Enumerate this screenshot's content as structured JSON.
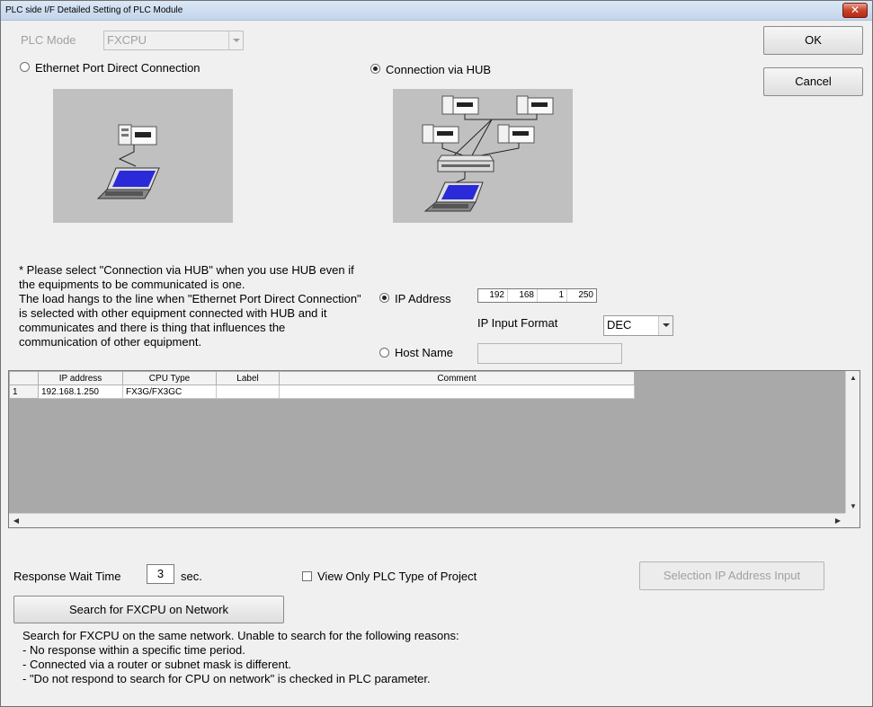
{
  "window": {
    "title": "PLC side I/F Detailed Setting of PLC Module",
    "close_label": "✕"
  },
  "buttons": {
    "ok": "OK",
    "cancel": "Cancel",
    "search": "Search for FXCPU on Network",
    "selection_ip": "Selection IP Address Input"
  },
  "plc_mode": {
    "label": "PLC Mode",
    "value": "FXCPU"
  },
  "connection": {
    "direct_label": "Ethernet Port Direct Connection",
    "hub_label": "Connection via HUB",
    "selected": "hub"
  },
  "note_lines": [
    "* Please select \"Connection via HUB\" when you use HUB even if",
    "the equipments to be communicated is one.",
    "The load hangs to the line when \"Ethernet Port Direct Connection\"",
    "is selected with other equipment connected with HUB and it",
    "communicates and there is thing that influences the",
    "communication of other equipment."
  ],
  "address": {
    "ip_label": "IP Address",
    "ip_octets": [
      "192",
      "168",
      "1",
      "250"
    ],
    "input_format_label": "IP Input Format",
    "input_format_value": "DEC",
    "host_label": "Host Name",
    "selected": "ip"
  },
  "grid": {
    "columns": [
      "IP address",
      "CPU Type",
      "Label",
      "Comment"
    ],
    "rows": [
      {
        "num": "1",
        "ip": "192.168.1.250",
        "cpu": "FX3G/FX3GC",
        "label": "",
        "comment": ""
      }
    ]
  },
  "response": {
    "label": "Response Wait Time",
    "value": "3",
    "unit": "sec."
  },
  "view_only": {
    "label": "View Only PLC Type of Project",
    "checked": false
  },
  "info_lines": [
    "Search for FXCPU on the same network. Unable to search for the following reasons:",
    "- No response within a specific time period.",
    "- Connected via a router or subnet mask is different.",
    "- \"Do not respond to search for CPU on network\" is checked in PLC parameter."
  ],
  "colors": {
    "picture_bg": "#c0c0c0",
    "grid_bg": "#a9a9a9",
    "screen_blue": "#2a2ad8"
  }
}
